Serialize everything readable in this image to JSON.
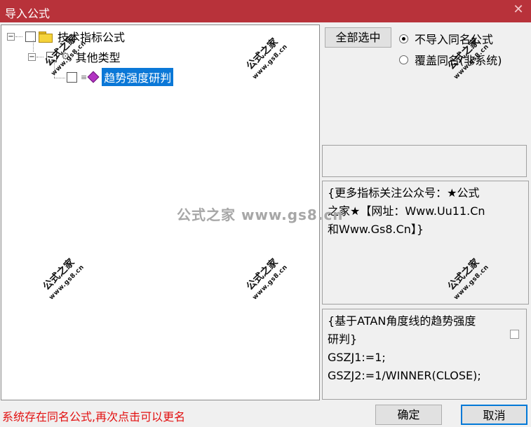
{
  "window": {
    "title": "导入公式"
  },
  "tree": {
    "root": {
      "label": "技术指标公式",
      "expand": "−"
    },
    "child": {
      "label": "其他类型",
      "expand": "−"
    },
    "leaf": {
      "label": "趋势强度研判"
    }
  },
  "options": {
    "select_all": "全部选中",
    "radio_no_import": "不导入同名公式",
    "radio_overwrite": "覆盖同名(非系统)"
  },
  "info_text": "{更多指标关注公众号：★公式\n之家★【网址：Www.Uu11.Cn\n和Www.Gs8.Cn】}",
  "code_text": "{基于ATAN角度线的趋势强度\n研判}\nGSZJ1:=1;\nGSZJ2:=1/WINNER(CLOSE);",
  "status": "系统存在同名公式,再次点击可以更名",
  "buttons": {
    "ok": "确定",
    "cancel": "取消"
  },
  "watermark": {
    "small_name": "公式之家",
    "small_url": "www.gs8.cn",
    "big": "公式之家 www.gs8.cn"
  }
}
